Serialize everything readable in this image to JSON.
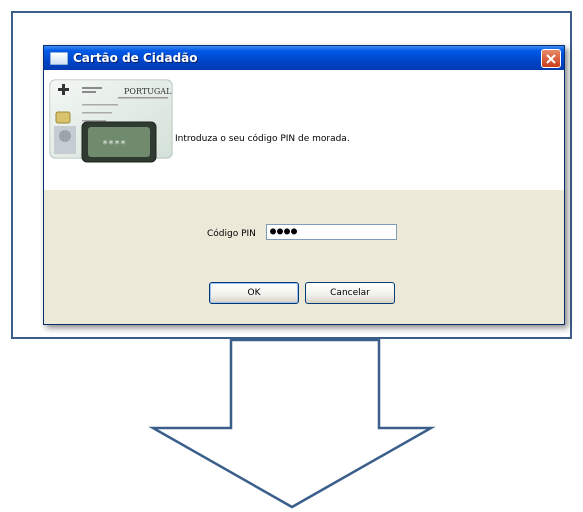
{
  "dialog": {
    "title": "Cartão de Cidadão",
    "message": "Introduza o seu código PIN de morada.",
    "pin_label": "Código PIN",
    "pin_value": "●●●●",
    "ok_label": "OK",
    "cancel_label": "Cancelar",
    "close_icon": "close-icon",
    "title_icon": "card-icon"
  },
  "card_art": {
    "country": "PORTUGAL",
    "pin_mask": "****"
  },
  "colors": {
    "frame": "#3b5f8a",
    "titlebar": "#0054e3",
    "close": "#d9532b",
    "dialog_bg": "#ece9d8"
  }
}
